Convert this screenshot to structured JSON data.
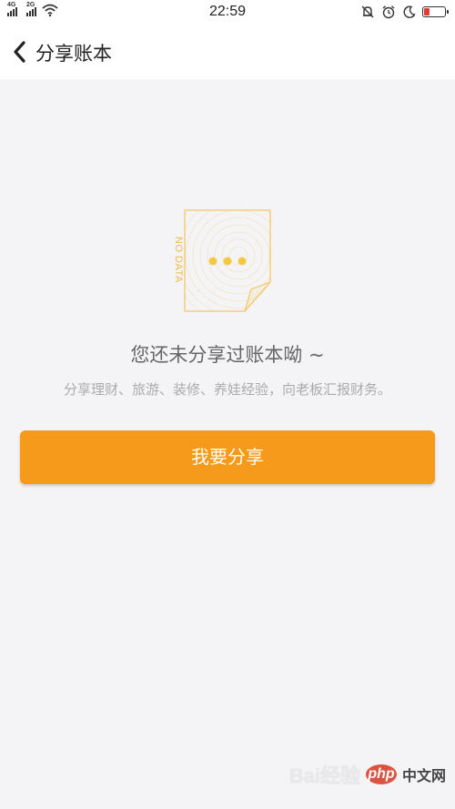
{
  "status_bar": {
    "net1": "4G",
    "net2": "2G",
    "time": "22:59",
    "battery_level": 0.25,
    "battery_color": "#e53935",
    "icons": [
      "signal-icon",
      "wifi-icon",
      "mute-bell-icon",
      "alarm-icon",
      "moon-icon",
      "battery-icon"
    ]
  },
  "nav": {
    "title": "分享账本",
    "back_icon": "chevron-left-icon"
  },
  "empty": {
    "illustration_label": "NO DATA",
    "title": "您还未分享过账本呦 ~",
    "subtitle": "分享理财、旅游、装修、养娃经验，向老板汇报财务。"
  },
  "action": {
    "share_label": "我要分享"
  },
  "watermark": {
    "baidu": "Bai",
    "baidu2": "经验",
    "php": "php",
    "site": "中文网"
  },
  "colors": {
    "accent": "#f59a1b",
    "illustration_line": "#f3cf7d",
    "dots": "#f5c842"
  }
}
